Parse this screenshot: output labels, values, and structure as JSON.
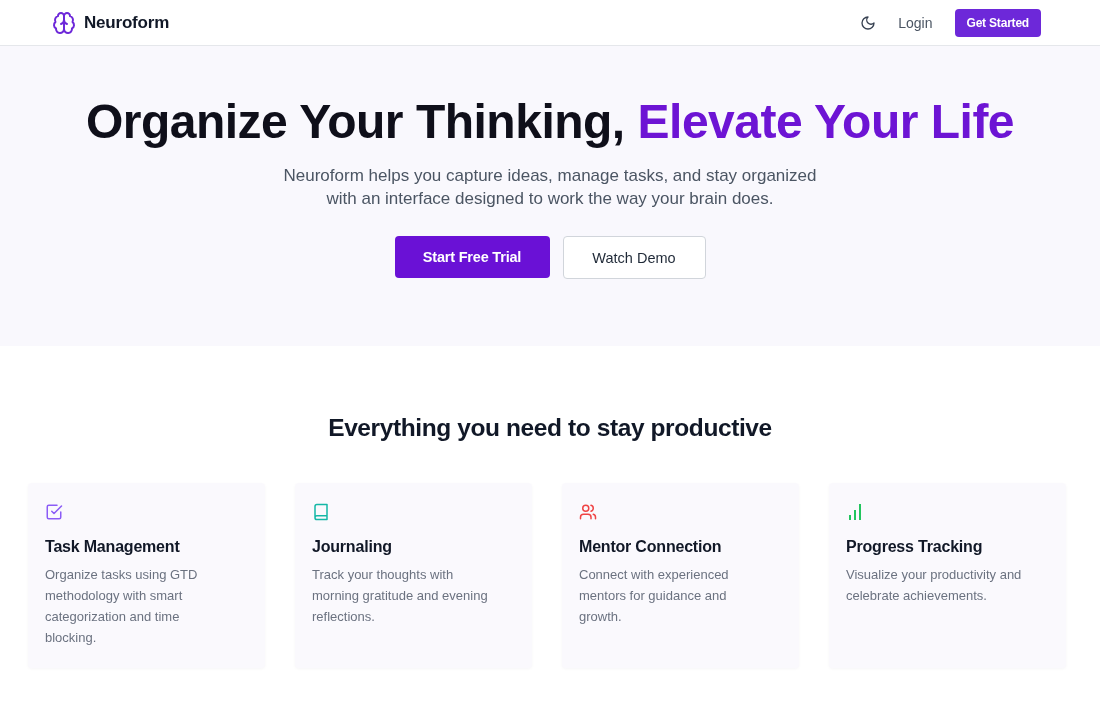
{
  "nav": {
    "brand": "Neuroform",
    "login": "Login",
    "cta": "Get Started"
  },
  "hero": {
    "title": "Organize Your Thinking, ",
    "title_accent": "Elevate Your Life",
    "subtitle": "Neuroform helps you capture ideas, manage tasks, and stay organized with an interface designed to work the way your brain does.",
    "primary_button": "Start Free Trial",
    "secondary_button": "Watch Demo"
  },
  "features": {
    "heading": "Everything you need to stay productive",
    "items": [
      {
        "title": "Task Management",
        "description": "Organize tasks using GTD methodology with smart categorization and time blocking.",
        "color": "#8b5cf6"
      },
      {
        "title": "Journaling",
        "description": "Track your thoughts with morning gratitude and evening reflections.",
        "color": "#14b8a6"
      },
      {
        "title": "Mentor Connection",
        "description": "Connect with experienced mentors for guidance and growth.",
        "color": "#ef4444"
      },
      {
        "title": "Progress Tracking",
        "description": "Visualize your productivity and celebrate achievements.",
        "color": "#22c55e"
      }
    ]
  }
}
